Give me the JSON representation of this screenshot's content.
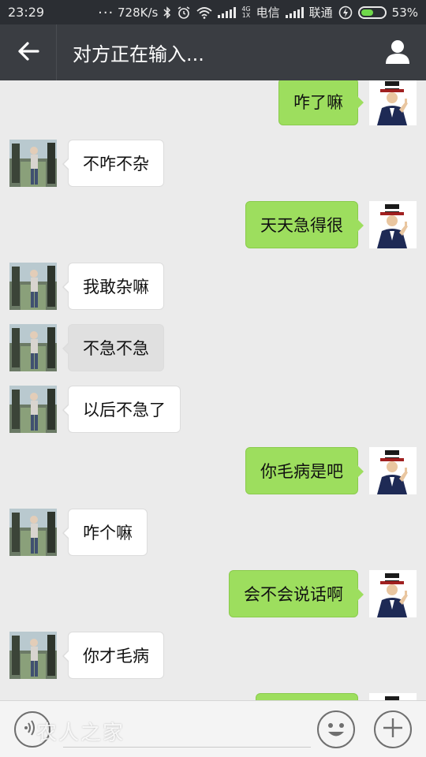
{
  "status_bar": {
    "time": "23:29",
    "dots": "...",
    "net_speed": "728K/s",
    "carrier1": "电信",
    "carrier2": "联通",
    "battery": "53%",
    "battery_level": 0.53,
    "net_type": "4G",
    "net_sub": "1X",
    "icons": [
      "bluetooth-icon",
      "alarm-icon",
      "wifi-icon",
      "signal-icon",
      "charging-icon",
      "battery-icon"
    ]
  },
  "header": {
    "title": "对方正在输入...",
    "icons": [
      "back-arrow-icon",
      "profile-icon"
    ]
  },
  "messages": [
    {
      "side": "right",
      "text": "咋了嘛"
    },
    {
      "side": "left",
      "text": "不咋不杂"
    },
    {
      "side": "right",
      "text": "天天急得很"
    },
    {
      "side": "left",
      "text": "我敢杂嘛"
    },
    {
      "side": "left",
      "text": "不急不急",
      "pressed": true
    },
    {
      "side": "left",
      "text": "以后不急了"
    },
    {
      "side": "right",
      "text": "你毛病是吧"
    },
    {
      "side": "left",
      "text": "咋个嘛"
    },
    {
      "side": "right",
      "text": "会不会说话啊"
    },
    {
      "side": "left",
      "text": "你才毛病"
    },
    {
      "side": "right",
      "text": ""
    }
  ],
  "input_bar": {
    "value": "",
    "watermark": "农人之家",
    "icons": [
      "voice-icon",
      "emoji-icon",
      "plus-icon"
    ]
  },
  "colors": {
    "title_bar": "#3a3d42",
    "status_bar": "#2b2e33",
    "chat_bg": "#ebebeb",
    "sent_bubble": "#9dde5e",
    "received_bubble": "#ffffff"
  }
}
